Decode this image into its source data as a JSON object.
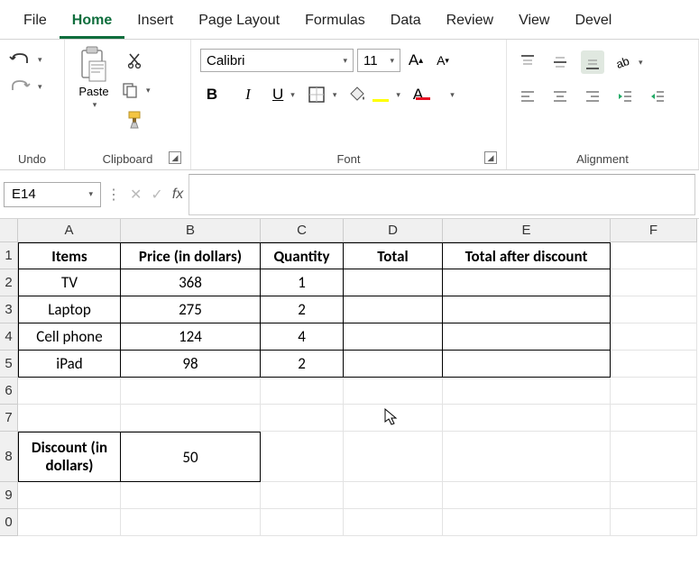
{
  "tabs": [
    "File",
    "Home",
    "Insert",
    "Page Layout",
    "Formulas",
    "Data",
    "Review",
    "View",
    "Devel"
  ],
  "active_tab": "Home",
  "groups": {
    "undo": "Undo",
    "clipboard": "Clipboard",
    "font": "Font",
    "alignment": "Alignment"
  },
  "clipboard": {
    "paste": "Paste"
  },
  "font": {
    "name": "Calibri",
    "size": "11",
    "bold": "B",
    "italic": "I",
    "underline": "U"
  },
  "namebox": "E14",
  "fx": "fx",
  "columns": [
    "A",
    "B",
    "C",
    "D",
    "E",
    "F"
  ],
  "rows": [
    "1",
    "2",
    "3",
    "4",
    "5",
    "6",
    "7",
    "8",
    "9",
    "0"
  ],
  "headers": {
    "items": "Items",
    "price": "Price (in dollars)",
    "qty": "Quantity",
    "total": "Total",
    "tad": "Total after discount"
  },
  "data": [
    {
      "item": "TV",
      "price": "368",
      "qty": "1"
    },
    {
      "item": "Laptop",
      "price": "275",
      "qty": "2"
    },
    {
      "item": "Cell phone",
      "price": "124",
      "qty": "4"
    },
    {
      "item": "iPad",
      "price": "98",
      "qty": "2"
    }
  ],
  "discount": {
    "label": "Discount (in dollars)",
    "value": "50"
  },
  "chart_data": {
    "type": "table",
    "headers": [
      "Items",
      "Price (in dollars)",
      "Quantity",
      "Total",
      "Total after discount"
    ],
    "rows": [
      [
        "TV",
        368,
        1,
        null,
        null
      ],
      [
        "Laptop",
        275,
        2,
        null,
        null
      ],
      [
        "Cell phone",
        124,
        4,
        null,
        null
      ],
      [
        "iPad",
        98,
        2,
        null,
        null
      ]
    ],
    "extra": {
      "Discount (in dollars)": 50
    }
  }
}
